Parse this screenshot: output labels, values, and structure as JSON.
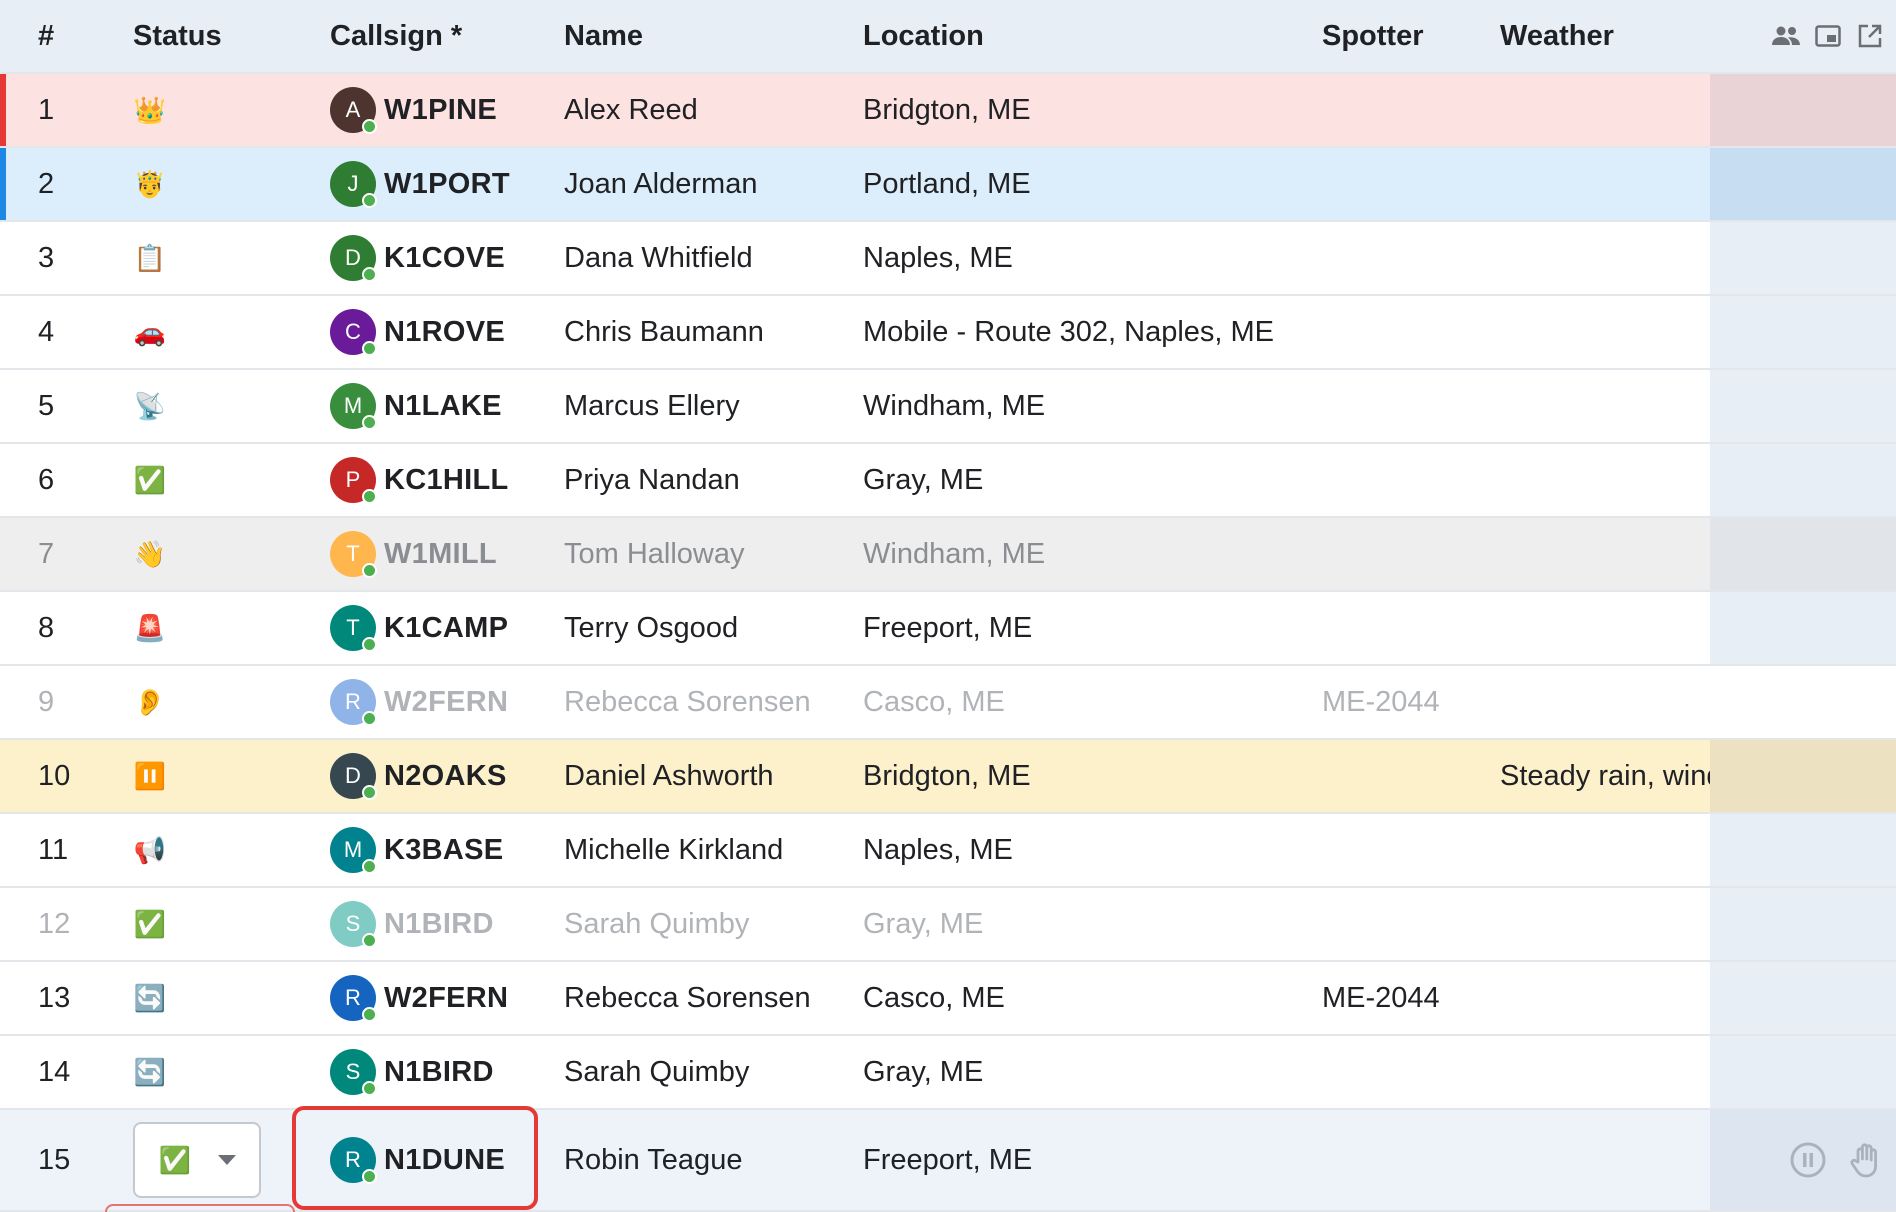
{
  "header": {
    "num": "#",
    "status": "Status",
    "callsign": "Callsign *",
    "name": "Name",
    "location": "Location",
    "spotter": "Spotter",
    "weather": "Weather",
    "icons": [
      "people-icon",
      "picture-in-picture-icon",
      "open-in-new-icon"
    ]
  },
  "colors": {
    "header_bg": "#e8eef5",
    "net_control_row": "#fde2e2",
    "net_control_stripe": "#e53935",
    "logger_row": "#dceefc",
    "logger_stripe": "#1e88e5",
    "checked_out_row": "#eeeeee",
    "paused_row": "#fdf1cc",
    "active_row": "#eef3fa",
    "focus_ring": "#e53935"
  },
  "rows": [
    {
      "num": "1",
      "status": "crown-icon",
      "status_glyph": "👑",
      "initial": "A",
      "avatar_color": "#4e342e",
      "callsign": "W1PINE",
      "name": "Alex Reed",
      "location": "Bridgton, ME",
      "spotter": "",
      "weather": "",
      "bg": "#fde2e2",
      "actions_bg": "#e9d3d6",
      "stripe": "#e53935",
      "tone": "normal"
    },
    {
      "num": "2",
      "status": "prince-icon",
      "status_glyph": "🤴",
      "initial": "J",
      "avatar_color": "#2e7d32",
      "callsign": "W1PORT",
      "name": "Joan Alderman",
      "location": "Portland, ME",
      "spotter": "",
      "weather": "",
      "bg": "#dceefc",
      "actions_bg": "#c6ddf2",
      "stripe": "#1e88e5",
      "tone": "normal"
    },
    {
      "num": "3",
      "status": "clipboard-icon",
      "status_glyph": "📋",
      "initial": "D",
      "avatar_color": "#2e7d32",
      "callsign": "K1COVE",
      "name": "Dana Whitfield",
      "location": "Naples, ME",
      "spotter": "",
      "weather": "",
      "bg": "#ffffff",
      "actions_bg": "#e8eef5",
      "stripe": "",
      "tone": "normal"
    },
    {
      "num": "4",
      "status": "car-icon",
      "status_glyph": "🚗",
      "initial": "C",
      "avatar_color": "#6a1b9a",
      "callsign": "N1ROVE",
      "name": "Chris Baumann",
      "location": "Mobile - Route 302, Naples, ME",
      "spotter": "",
      "weather": "",
      "bg": "#ffffff",
      "actions_bg": "#e8eef5",
      "stripe": "",
      "tone": "normal"
    },
    {
      "num": "5",
      "status": "satellite-dish-icon",
      "status_glyph": "📡",
      "initial": "M",
      "avatar_color": "#388e3c",
      "callsign": "N1LAKE",
      "name": "Marcus Ellery",
      "location": "Windham, ME",
      "spotter": "",
      "weather": "",
      "bg": "#ffffff",
      "actions_bg": "#e8eef5",
      "stripe": "",
      "tone": "normal"
    },
    {
      "num": "6",
      "status": "check-mark-icon",
      "status_glyph": "✅",
      "initial": "P",
      "avatar_color": "#c62828",
      "callsign": "KC1HILL",
      "name": "Priya Nandan",
      "location": "Gray, ME",
      "spotter": "",
      "weather": "",
      "bg": "#ffffff",
      "actions_bg": "#e8eef5",
      "stripe": "",
      "tone": "normal"
    },
    {
      "num": "7",
      "status": "waving-hand-icon",
      "status_glyph": "👋",
      "initial": "T",
      "avatar_color": "#ffb74d",
      "callsign": "W1MILL",
      "name": "Tom Halloway",
      "location": "Windham, ME",
      "spotter": "",
      "weather": "",
      "bg": "#eeeeee",
      "actions_bg": "#e1e5ea",
      "stripe": "",
      "tone": "dim"
    },
    {
      "num": "8",
      "status": "siren-icon",
      "status_glyph": "🚨",
      "initial": "T",
      "avatar_color": "#00897b",
      "callsign": "K1CAMP",
      "name": "Terry Osgood",
      "location": "Freeport, ME",
      "spotter": "",
      "weather": "",
      "bg": "#ffffff",
      "actions_bg": "#e8eef5",
      "stripe": "",
      "tone": "normal"
    },
    {
      "num": "9",
      "status": "ear-icon",
      "status_glyph": "👂",
      "initial": "R",
      "avatar_color": "#90b4e8",
      "callsign": "W2FERN",
      "name": "Rebecca Sorensen",
      "location": "Casco, ME",
      "spotter": "ME-2044",
      "weather": "",
      "bg": "#ffffff",
      "actions_bg": "#ffffff",
      "stripe": "",
      "tone": "faded"
    },
    {
      "num": "10",
      "status": "pause-icon",
      "status_glyph": "⏸️",
      "initial": "D",
      "avatar_color": "#37474f",
      "callsign": "N2OAKS",
      "name": "Daniel Ashworth",
      "location": "Bridgton, ME",
      "spotter": "",
      "weather": "Steady rain, wind",
      "bg": "#fdf1cc",
      "actions_bg": "#ece2c2",
      "stripe": "",
      "tone": "normal"
    },
    {
      "num": "11",
      "status": "megaphone-icon",
      "status_glyph": "📢",
      "initial": "M",
      "avatar_color": "#00838f",
      "callsign": "K3BASE",
      "name": "Michelle Kirkland",
      "location": "Naples, ME",
      "spotter": "",
      "weather": "",
      "bg": "#ffffff",
      "actions_bg": "#e8eef5",
      "stripe": "",
      "tone": "normal"
    },
    {
      "num": "12",
      "status": "check-mark-icon",
      "status_glyph": "✅",
      "initial": "S",
      "avatar_color": "#80cbc4",
      "callsign": "N1BIRD",
      "name": "Sarah Quimby",
      "location": "Gray, ME",
      "spotter": "",
      "weather": "",
      "bg": "#ffffff",
      "actions_bg": "#e8eef5",
      "stripe": "",
      "tone": "faded"
    },
    {
      "num": "13",
      "status": "refresh-icon",
      "status_glyph": "🔄",
      "initial": "R",
      "avatar_color": "#1565c0",
      "callsign": "W2FERN",
      "name": "Rebecca Sorensen",
      "location": "Casco, ME",
      "spotter": "ME-2044",
      "weather": "",
      "bg": "#ffffff",
      "actions_bg": "#e8eef5",
      "stripe": "",
      "tone": "normal"
    },
    {
      "num": "14",
      "status": "refresh-icon",
      "status_glyph": "🔄",
      "initial": "S",
      "avatar_color": "#00897b",
      "callsign": "N1BIRD",
      "name": "Sarah Quimby",
      "location": "Gray, ME",
      "spotter": "",
      "weather": "",
      "bg": "#ffffff",
      "actions_bg": "#e8eef5",
      "stripe": "",
      "tone": "normal"
    },
    {
      "num": "15",
      "status": "check-mark-icon",
      "status_glyph": "✅",
      "initial": "R",
      "avatar_color": "#00838f",
      "callsign": "N1DUNE",
      "name": "Robin Teague",
      "location": "Freeport, ME",
      "spotter": "",
      "weather": "",
      "bg": "#eef3fa",
      "actions_bg": "#dde6f0",
      "stripe": "",
      "tone": "normal",
      "editing": true
    }
  ],
  "row15_actions": [
    "pause-circle-icon",
    "raised-hand-icon"
  ]
}
